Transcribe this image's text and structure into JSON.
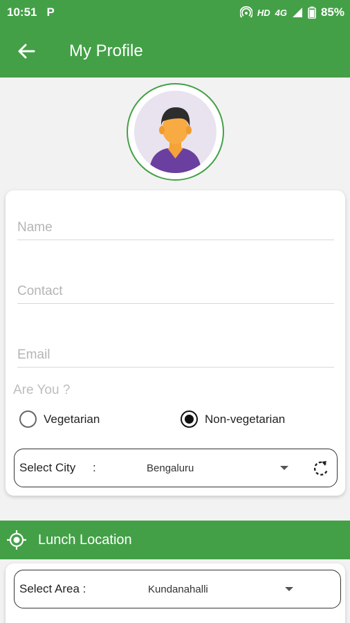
{
  "status_bar": {
    "time": "10:51",
    "app_notification": "P",
    "network": "HD",
    "signal": "4G",
    "battery": "85%"
  },
  "app_bar": {
    "title": "My Profile",
    "back_icon": "arrow-left-icon"
  },
  "avatar": {
    "icon": "user-avatar-icon"
  },
  "form": {
    "name_placeholder": "Name",
    "contact_placeholder": "Contact",
    "email_placeholder": "Email",
    "are_you_label": "Are You ?",
    "diet_options": [
      {
        "label": "Vegetarian",
        "checked": false
      },
      {
        "label": "Non-vegetarian",
        "checked": true
      }
    ],
    "city": {
      "label": "Select City",
      "colon": ":",
      "value": "Bengaluru",
      "refresh_icon": "refresh-icon"
    }
  },
  "lunch_location": {
    "title": "Lunch Location",
    "icon": "gps-target-icon",
    "area": {
      "label": "Select Area :",
      "value": "Kundanahalli"
    }
  },
  "colors": {
    "primary_green": "#43a047",
    "background": "#f2f2f2"
  }
}
